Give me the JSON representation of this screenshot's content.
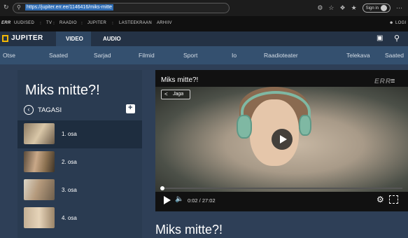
{
  "browser": {
    "url": "https://jupiter.err.ee/1146416/miks-mitte",
    "signin_label": "Sign in",
    "icons": [
      "refresh-icon",
      "lock-icon",
      "extension-icon",
      "favorite-icon",
      "collections-icon",
      "more-icon"
    ]
  },
  "errnav": {
    "logo": "ERR",
    "items": [
      "UUDISED",
      "TV",
      "RAADIO",
      "JUPITER",
      "LASTEEKRAAN",
      "ARHIIV"
    ],
    "login": "LOGI"
  },
  "jupiter": {
    "logo": "JUPITER",
    "tabs": [
      "VIDEO",
      "AUDIO"
    ]
  },
  "categories": [
    "Otse",
    "Saated",
    "Sarjad",
    "Filmid",
    "Sport",
    "Io",
    "Raadioteater",
    "Telekava",
    "Saated"
  ],
  "sidebar": {
    "title": "Miks mitte?!",
    "back_label": "TAGASI",
    "episodes": [
      "1. osa",
      "2. osa",
      "3. osa",
      "4. osa"
    ],
    "active_episode": 0
  },
  "player": {
    "title": "Miks mitte?!",
    "share_label": "Jaga",
    "watermark": "ERR",
    "timecode": "0:02 / 27:02",
    "progress": 0.0012
  },
  "content": {
    "title": "Miks mitte?!"
  },
  "colors": {
    "page_bg": "#2e3f57",
    "sidebar_bg": "#2a3b51",
    "accent_yellow": "#f2b705"
  }
}
